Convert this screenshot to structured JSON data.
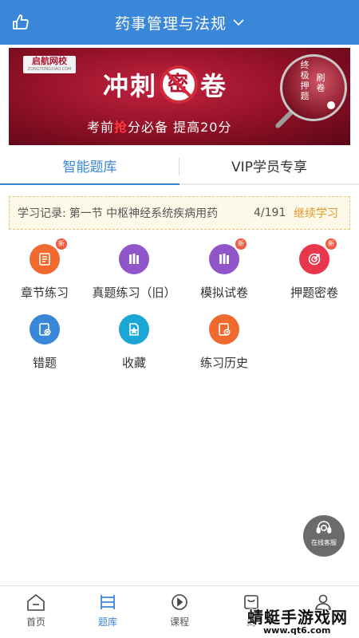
{
  "header": {
    "title": "药事管理与法规"
  },
  "banner": {
    "logo": "启航网校",
    "logo_sub": "ZONGTONGXIAO.COM",
    "headline_a": "冲刺",
    "headline_mi": "密",
    "headline_b": "卷",
    "sub_a": "考前",
    "sub_red": "抢",
    "sub_b": "分必备   提高20分",
    "lens_v1": "终极押题",
    "lens_v2": "刷卷"
  },
  "tabs": [
    {
      "label": "智能题库"
    },
    {
      "label": "VIP学员专享"
    }
  ],
  "record": {
    "label": "学习记录:",
    "chapter": "第一节 中枢神经系统疾病用药",
    "progress": "4/191",
    "continue": "继续学习"
  },
  "grid": [
    {
      "label": "章节练习",
      "badge": "新",
      "color": "#f06a2f",
      "icon": "note-icon"
    },
    {
      "label": "真题练习（旧）",
      "badge": "",
      "color": "#9056c9",
      "icon": "books-icon"
    },
    {
      "label": "模拟试卷",
      "badge": "新",
      "color": "#9056c9",
      "icon": "books-icon"
    },
    {
      "label": "押题密卷",
      "badge": "新",
      "color": "#e8364c",
      "icon": "target-icon"
    },
    {
      "label": "错题",
      "badge": "",
      "color": "#3a86d8",
      "icon": "wrong-doc-icon"
    },
    {
      "label": "收藏",
      "badge": "",
      "color": "#1ba6d6",
      "icon": "star-doc-icon"
    },
    {
      "label": "练习历史",
      "badge": "",
      "color": "#f06a2f",
      "icon": "clock-doc-icon"
    }
  ],
  "support": {
    "label": "在线客服"
  },
  "nav": [
    {
      "label": "首页"
    },
    {
      "label": "题库"
    },
    {
      "label": "课程"
    },
    {
      "label": "商"
    },
    {
      "label": ""
    }
  ],
  "watermark": {
    "line1": "蜻蜓手游戏网",
    "line2": "www.qt6.com"
  },
  "colors": {
    "primary": "#3a86d8",
    "accent": "#e29a2b",
    "banner": "#a8162f"
  }
}
